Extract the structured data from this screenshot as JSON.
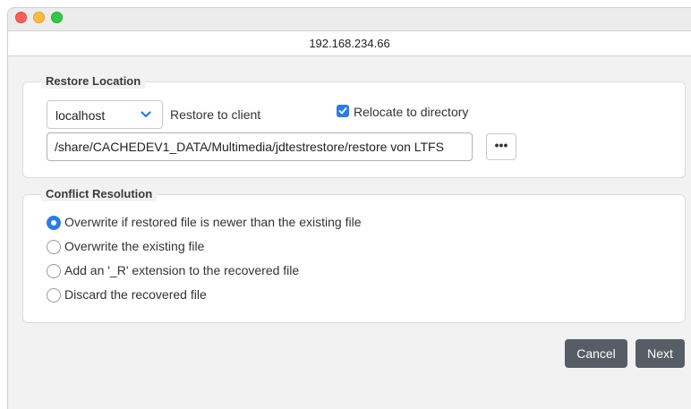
{
  "window": {
    "url": "192.168.234.66"
  },
  "restore_location": {
    "title": "Restore Location",
    "client_select": {
      "value": "localhost"
    },
    "restore_to_client_label": "Restore to client",
    "relocate_checkbox": {
      "label": "Relocate to directory",
      "checked": true
    },
    "path_value": "/share/CACHEDEV1_DATA/Multimedia/jdtestrestore/restore von LTFS",
    "browse_label": "•••"
  },
  "conflict_resolution": {
    "title": "Conflict Resolution",
    "options": [
      {
        "label": "Overwrite if restored file is newer than the existing file",
        "checked": true
      },
      {
        "label": "Overwrite the existing file",
        "checked": false
      },
      {
        "label": "Add an '_R' extension to the recovered file",
        "checked": false
      },
      {
        "label": "Discard the recovered file",
        "checked": false
      }
    ]
  },
  "footer": {
    "cancel_label": "Cancel",
    "next_label": "Next"
  },
  "colors": {
    "accent": "#2d7ddf",
    "button": "#565d66"
  }
}
